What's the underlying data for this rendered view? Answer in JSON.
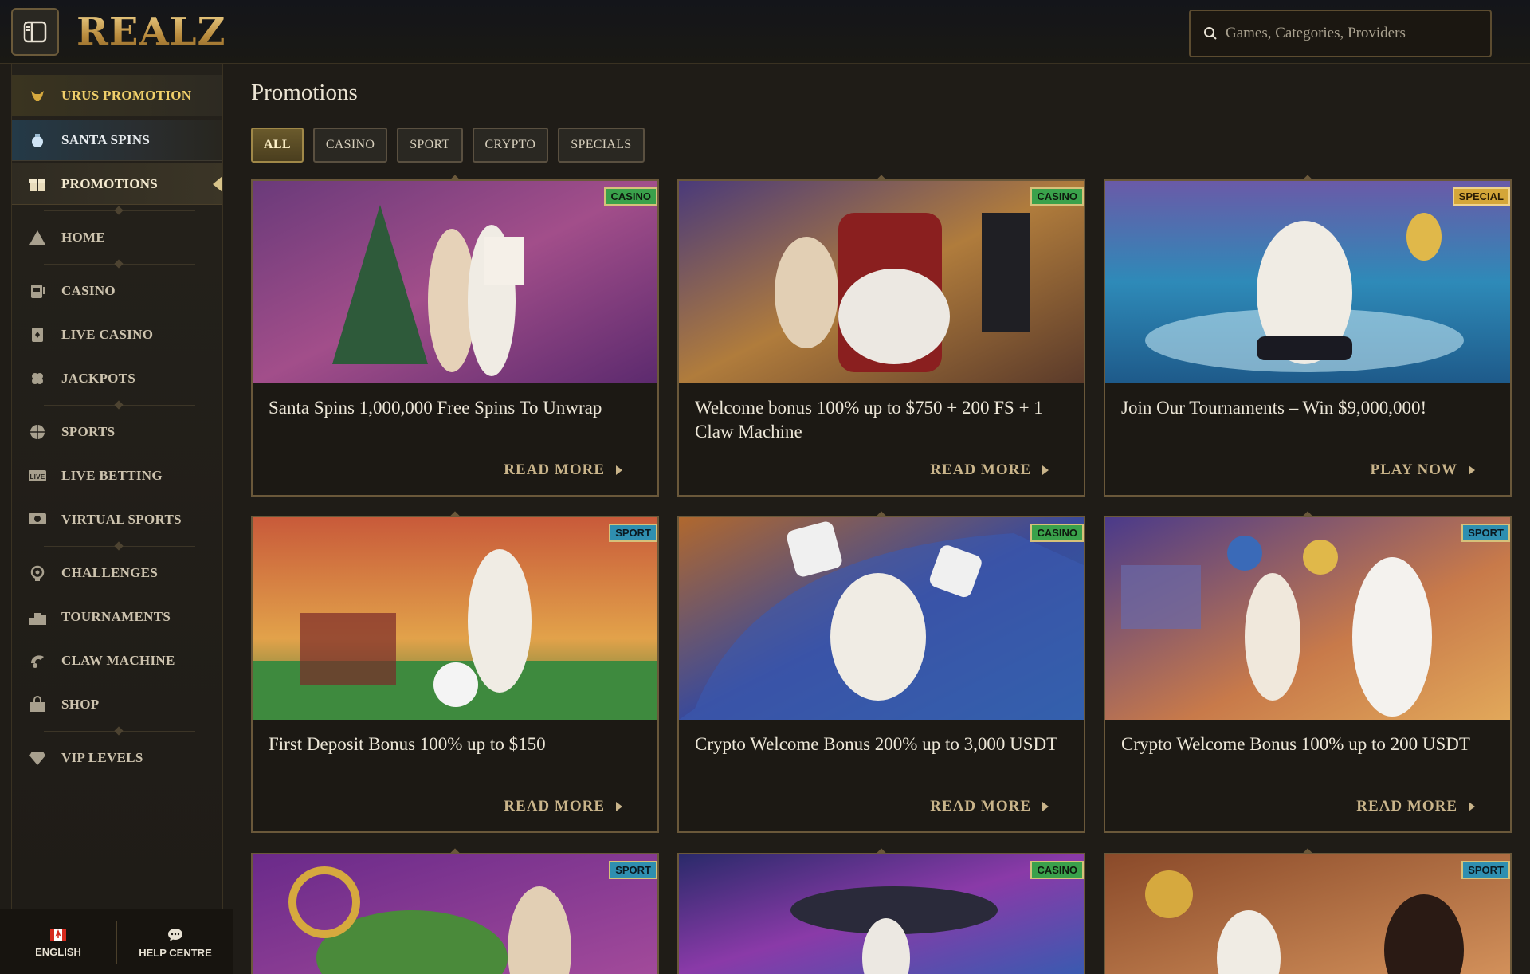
{
  "header": {
    "logo": "REALZ",
    "search_placeholder": "Games, Categories, Providers"
  },
  "sidebar": {
    "items": [
      {
        "label": "URUS PROMOTION",
        "icon": "bull-icon"
      },
      {
        "label": "SANTA SPINS",
        "icon": "ornament-icon"
      },
      {
        "label": "PROMOTIONS",
        "icon": "gift-icon"
      },
      {
        "label": "HOME",
        "icon": "pyramid-icon"
      },
      {
        "label": "CASINO",
        "icon": "slot-machine-icon"
      },
      {
        "label": "LIVE CASINO",
        "icon": "card-icon"
      },
      {
        "label": "JACKPOTS",
        "icon": "clover-icon"
      },
      {
        "label": "SPORTS",
        "icon": "basketball-icon"
      },
      {
        "label": "LIVE BETTING",
        "icon": "live-icon"
      },
      {
        "label": "VIRTUAL SPORTS",
        "icon": "virtual-icon"
      },
      {
        "label": "CHALLENGES",
        "icon": "challenge-icon"
      },
      {
        "label": "TOURNAMENTS",
        "icon": "podium-icon"
      },
      {
        "label": "CLAW MACHINE",
        "icon": "claw-icon"
      },
      {
        "label": "SHOP",
        "icon": "shop-icon"
      },
      {
        "label": "VIP LEVELS",
        "icon": "diamond-icon"
      }
    ],
    "footer": {
      "language": "ENGLISH",
      "help": "HELP CENTRE"
    }
  },
  "main": {
    "title": "Promotions",
    "filters": [
      "ALL",
      "CASINO",
      "SPORT",
      "CRYPTO",
      "SPECIALS"
    ],
    "active_filter": "ALL",
    "cards": [
      {
        "title": "Santa Spins 1,000,000 Free Spins To Unwrap",
        "badge": "CASINO",
        "cta": "READ MORE"
      },
      {
        "title": "Welcome bonus 100% up to $750 + 200 FS + 1 Claw Machine",
        "badge": "CASINO",
        "cta": "READ MORE"
      },
      {
        "title": "Join Our Tournaments – Win $9,000,000!",
        "badge": "SPECIAL",
        "cta": "PLAY NOW"
      },
      {
        "title": "First Deposit Bonus 100% up to $150",
        "badge": "SPORT",
        "cta": "READ MORE"
      },
      {
        "title": "Crypto Welcome Bonus 200% up to 3,000 USDT",
        "badge": "CASINO",
        "cta": "READ MORE"
      },
      {
        "title": "Crypto Welcome Bonus 100% up to 200 USDT",
        "badge": "SPORT",
        "cta": "READ MORE"
      },
      {
        "title": "",
        "badge": "SPORT",
        "cta": ""
      },
      {
        "title": "",
        "badge": "CASINO",
        "cta": ""
      },
      {
        "title": "",
        "badge": "SPORT",
        "cta": ""
      }
    ]
  },
  "colors": {
    "background": "#1f1c17",
    "accent_gold": "#c9a45c",
    "casino_badge": "#3aa14b",
    "sport_badge": "#2f8fb0",
    "special_badge": "#d4a639"
  }
}
